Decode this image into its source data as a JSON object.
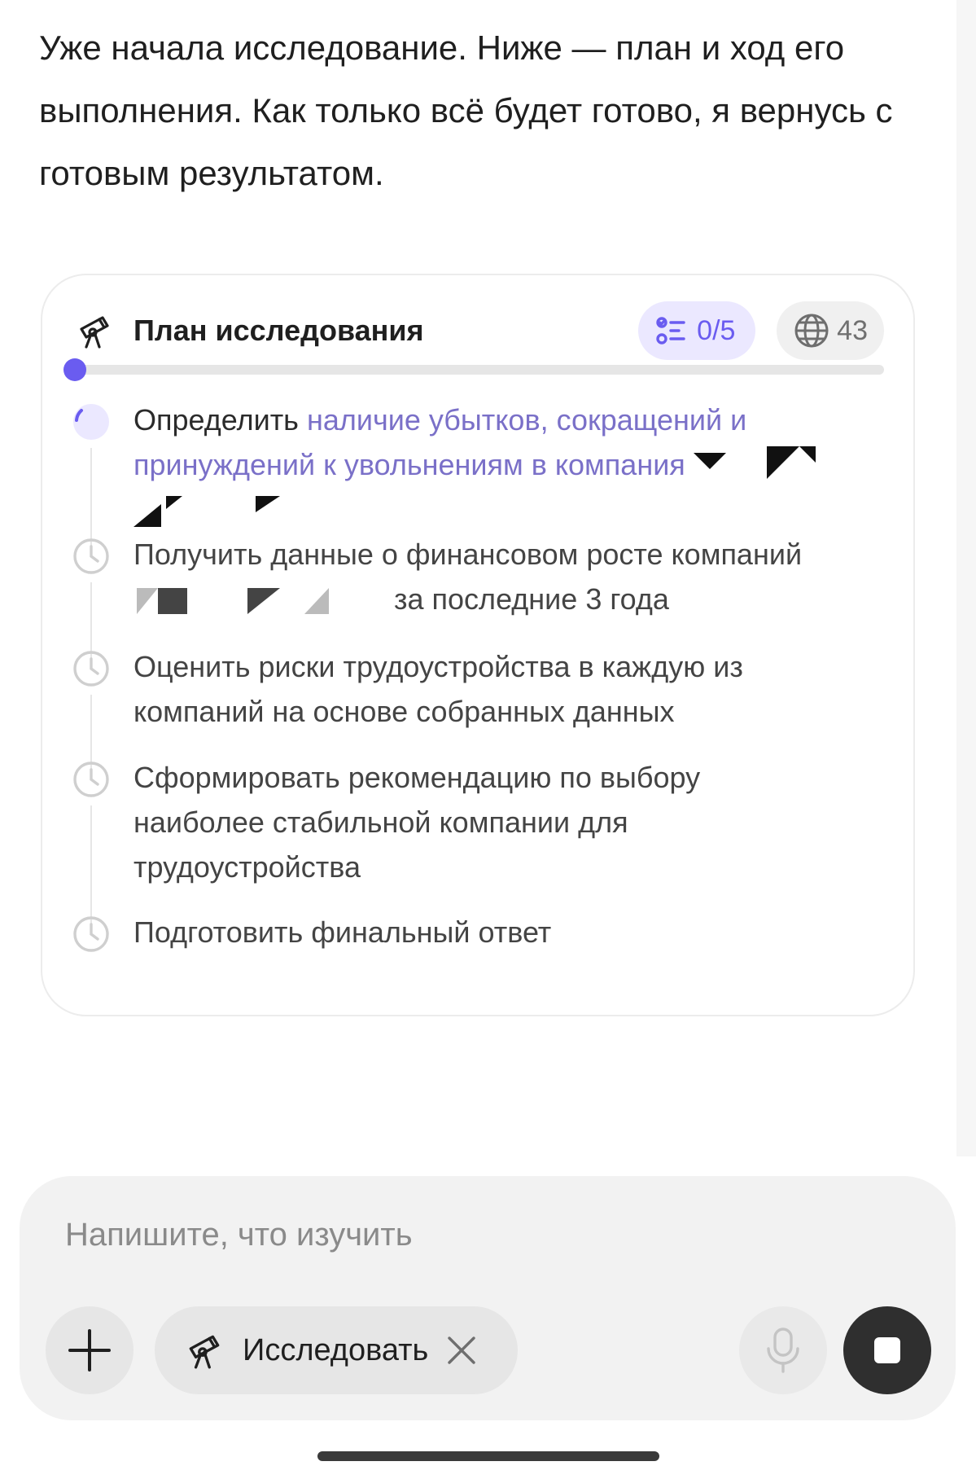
{
  "message": {
    "text": "Уже начала исследование. Ниже — план и ход его выполнения. Как только всё будет готово, я вернусь с готовым результатом."
  },
  "plan": {
    "title": "План исследования",
    "progress_label": "0/5",
    "progress_fraction": 0,
    "sources_count": "43",
    "accent_color": "#6a5cf0",
    "steps": [
      {
        "status": "in-progress",
        "text_start": "Определить",
        "text_fade": "наличие убытков, сокращений и",
        "text_line2_a": "принуждений к увольнениям",
        "text_line2_b": "в компания"
      },
      {
        "status": "pending",
        "text_line1": "Получить данные о финансовом росте компаний",
        "text_line2": "за последние 3 года"
      },
      {
        "status": "pending",
        "text": "Оценить риски трудоустройства в каждую из компаний на основе собранных данных"
      },
      {
        "status": "pending",
        "text": "Сформировать рекомендацию по выбору наиболее стабильной компании для трудоустройства"
      },
      {
        "status": "pending",
        "text": "Подготовить финальный ответ"
      }
    ]
  },
  "composer": {
    "placeholder": "Напишите, что изучить",
    "mode_chip_label": "Исследовать",
    "icons": [
      "plus-icon",
      "telescope-icon",
      "close-icon",
      "microphone-icon",
      "stop-icon"
    ]
  }
}
